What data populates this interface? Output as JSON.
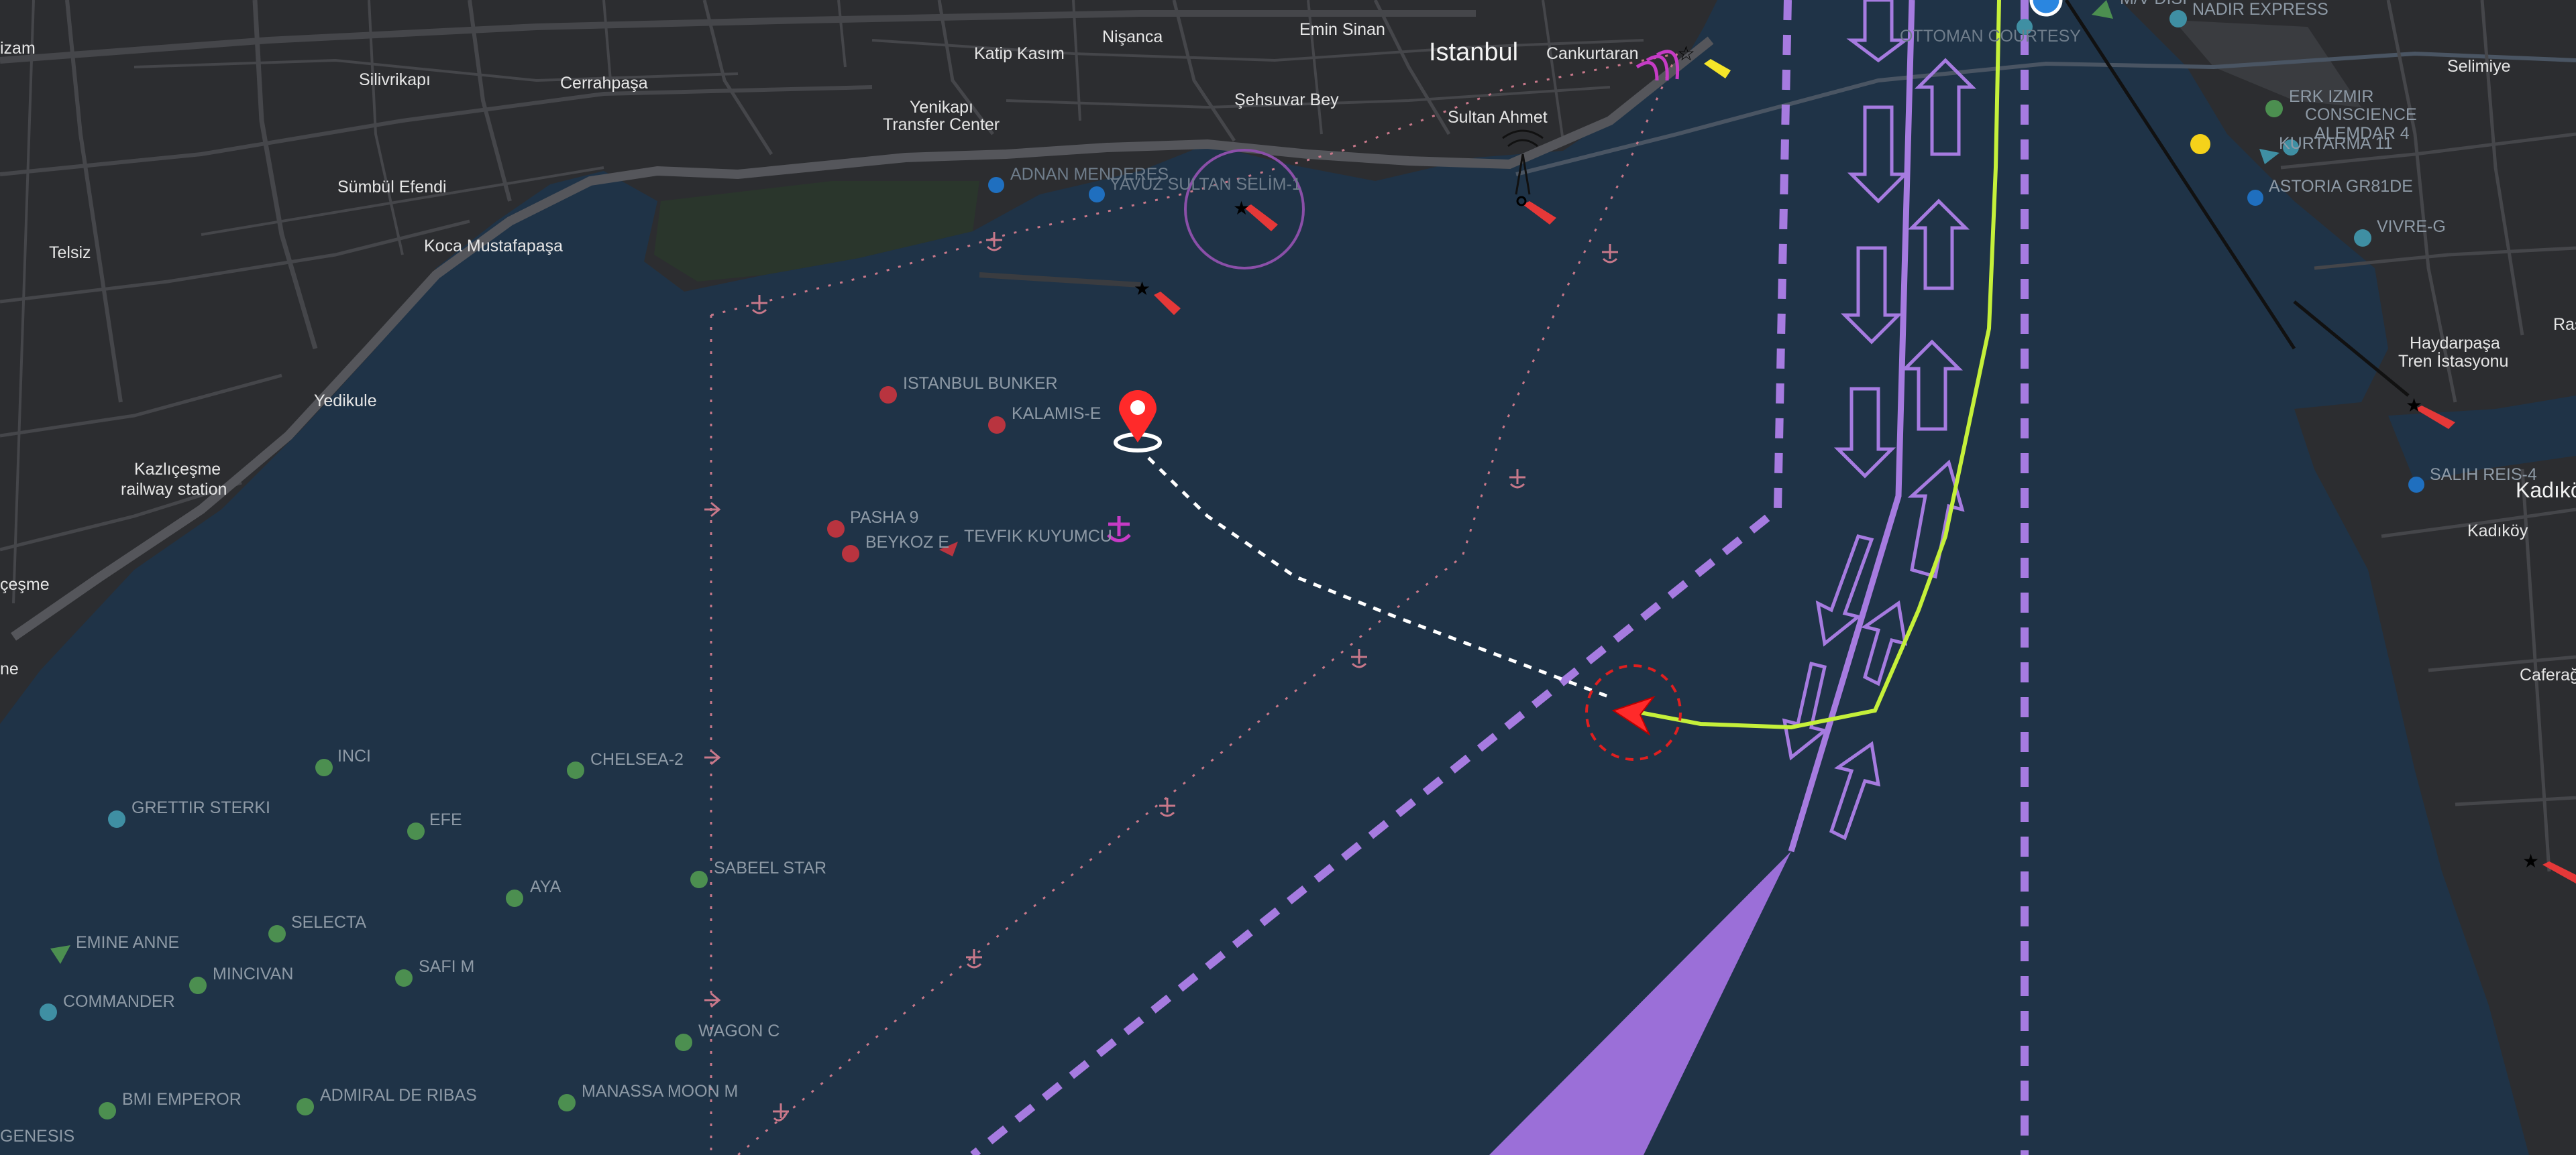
{
  "map": {
    "city_labels": {
      "istanbul": "Istanbul",
      "cankurtaran": "Cankurtaran",
      "sultan_ahmet": "Sultan Ahmet",
      "emin_sinan": "Emin Sinan",
      "nisanca": "Nişanca",
      "katip_kasim": "Katip Kasım",
      "sehsuvar_bey": "Şehsuvar Bey",
      "yenikapi_1": "Yenikapı",
      "yenikapi_2": "Transfer Center",
      "cerrahpasa": "Cerrahpaşa",
      "silivrikapi": "Silivrikapı",
      "sumbul_efendi": "Sümbül Efendi",
      "koca_mustafapasa": "Koca Mustafapaşa",
      "telsiz": "Telsiz",
      "yedikule": "Yedikule",
      "kazlicesme_1": "Kazlıçeşme",
      "kazlicesme_2": "railway station",
      "cesme_partial": "çeşme",
      "izam_partial": "izam",
      "ne_partial": "ne",
      "selimiye": "Selimiye",
      "haydarpasa_1": "Haydarpaşa",
      "haydarpasa_2": "Tren İstasyonu",
      "kadikoy_big": "Kadıkö",
      "kadikoy": "Kadıköy",
      "cafera_partial": "Caferağ",
      "ras_partial": "Ras"
    },
    "vessels": {
      "adnan_menderes": "ADNAN MENDERES",
      "yavuz_sultan_selim": "YAVUZ SULTAN SELİM-1",
      "istanbul_bunker": "ISTANBUL BUNKER",
      "kalamis_e": "KALAMIS-E",
      "pasha_9": "PASHA 9",
      "beykoz_e": "BEYKOZ E",
      "tevfik_kuyumcu": "TEVFIK KUYUMCU",
      "inci": "INCI",
      "chelsea_2": "CHELSEA-2",
      "grettir_sterki": "GRETTIR STERKI",
      "efe": "EFE",
      "aya": "AYA",
      "sabeel_star": "SABEEL STAR",
      "selecta": "SELECTA",
      "emine_anne": "EMINE ANNE",
      "mincivan": "MINCIVAN",
      "safi_m": "SAFI M",
      "commander": "COMMANDER",
      "wagon_c": "WAGON C",
      "bmi_emperor": "BMI EMPEROR",
      "admiral_de_ribas": "ADMIRAL DE RIBAS",
      "manassa_moon_m": "MANASSA MOON M",
      "genesis": "GENESIS",
      "ottoman_courtesy": "OTTOMAN COURTESY",
      "erk_izmir": "ERK IZMIR",
      "conscience": "CONSCIENCE",
      "alemdar": "ALEMDAR 4",
      "kurtarma": "KURTARMA 11",
      "astoria": "ASTORIA GR81DE",
      "vivre_g": "VIVRE-G",
      "salih_reis": "SALIH REIS-4",
      "nadir_express": "NADIR EXPRESS",
      "mv_partial": "M/V DISI"
    },
    "colors": {
      "water": "#1f3347",
      "land": "#2c2d30",
      "road": "#4a4b4f",
      "route_lime": "#c5f03a",
      "lane_purple": "#a67be0",
      "pin_red": "#ff2a2a",
      "vessel_green": "#4c8f50",
      "vessel_teal": "#3f8fa3",
      "vessel_red": "#b9343f",
      "anchorage_pink": "#c8788a"
    }
  }
}
